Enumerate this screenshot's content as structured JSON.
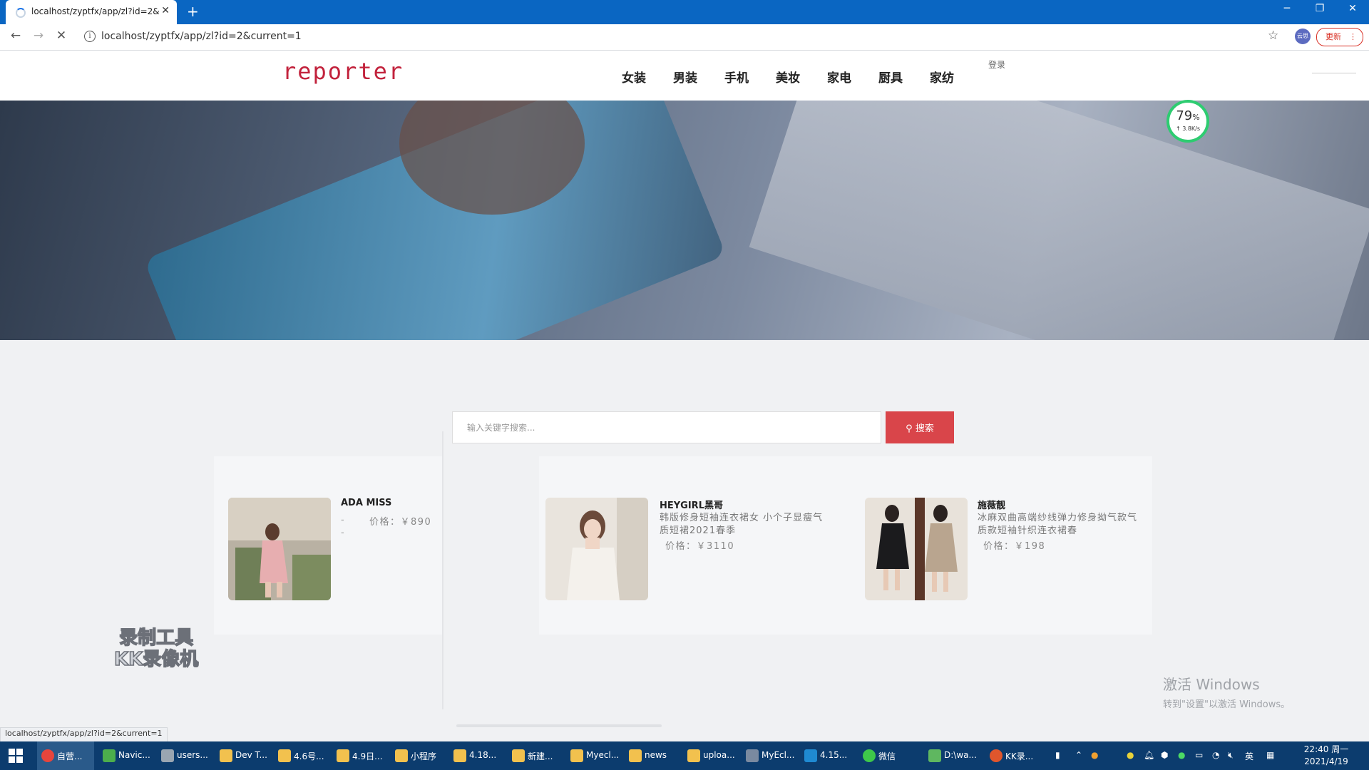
{
  "browser": {
    "tab_title": "localhost/zyptfx/app/zl?id=2&",
    "url": "localhost/zyptfx/app/zl?id=2&current=1",
    "update_label": "更新",
    "profile_label": "云思"
  },
  "header": {
    "logo": "reporter",
    "nav": [
      "女装",
      "男装",
      "手机",
      "美妆",
      "家电",
      "厨具",
      "家纺"
    ],
    "login": "登录"
  },
  "speed_badge": {
    "percent": "79",
    "unit": "%",
    "rate": "↑ 3.8K/s"
  },
  "search": {
    "placeholder": "输入关键字搜索...",
    "button_label": "搜索"
  },
  "products": [
    {
      "name": "ADA MISS",
      "desc": "- -",
      "price": "价格：￥890"
    },
    {
      "name": "HEYGIRL黑哥",
      "desc": "韩版修身短袖连衣裙女 小个子显瘦气质短裙2021春季",
      "price": "价格：￥3110"
    },
    {
      "name": "施薇靓",
      "desc": "冰麻双曲高端纱线弹力修身拗气款气质款短袖针织连衣裙春",
      "price": "价格：￥198"
    }
  ],
  "watermark": {
    "line1": "录制工具",
    "line2": "KK录像机"
  },
  "activate": {
    "title": "激活 Windows",
    "subtitle": "转到\"设置\"以激活 Windows。"
  },
  "status_url": "localhost/zyptfx/app/zl?id=2&current=1",
  "taskbar": {
    "items": [
      "自营...",
      "Navic...",
      "users...",
      "Dev T...",
      "4.6号...",
      "4.9日...",
      "小程序",
      "4.18...",
      "新建...",
      "Myecl...",
      "news",
      "uploa...",
      "MyEcl...",
      "4.15...",
      "微信",
      "D:\\wa...",
      "KK录..."
    ],
    "ime": "英",
    "time": "22:40 周一",
    "date": "2021/4/19"
  },
  "colors": {
    "accent": "#d9454a",
    "logo": "#c2223c",
    "titlebar": "#0a66c2",
    "taskbar": "#0c3c6e"
  }
}
